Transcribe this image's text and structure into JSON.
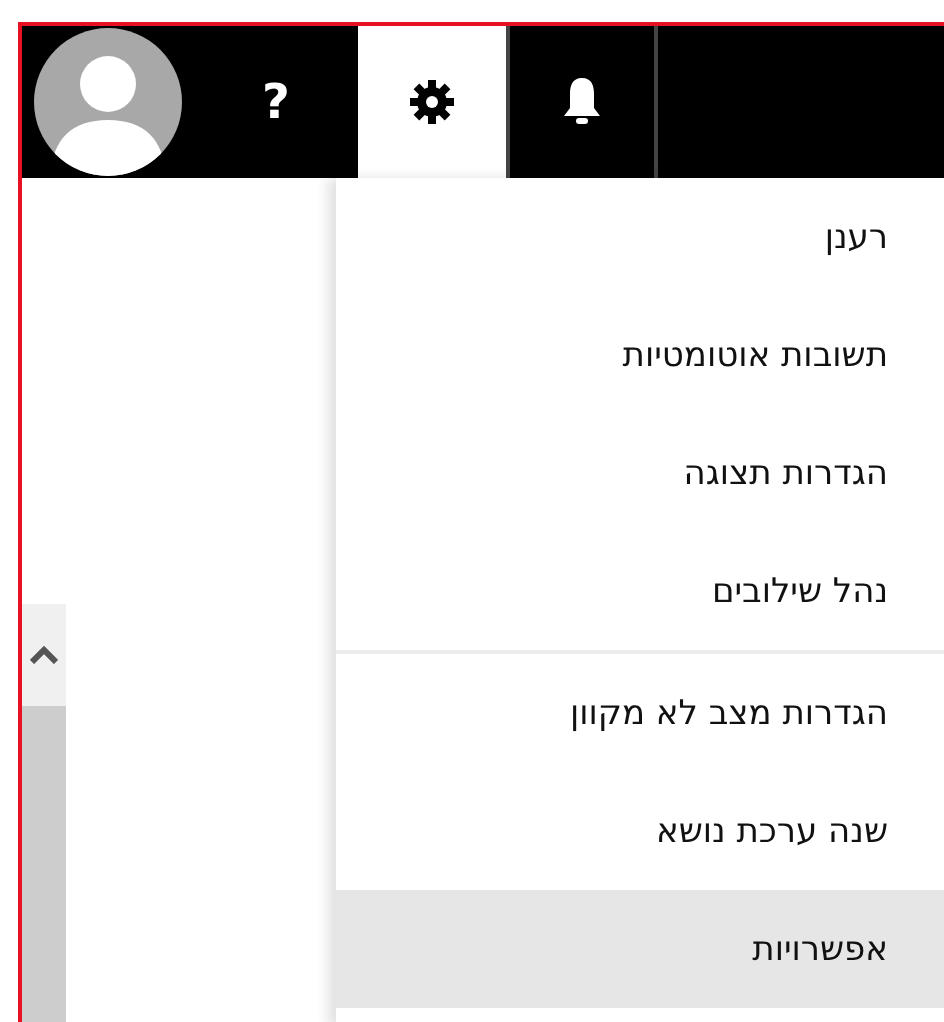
{
  "toolbar": [
    {
      "kind": "help",
      "text": "?",
      "selected": false
    },
    {
      "kind": "settings",
      "selected": true
    },
    {
      "kind": "notifications",
      "selected": false
    }
  ],
  "menu": {
    "groups": [
      {
        "items": [
          {
            "label": "רענן",
            "selected": false
          },
          {
            "label": "תשובות אוטומטיות",
            "selected": false
          },
          {
            "label": "הגדרות תצוגה",
            "selected": false
          },
          {
            "label": "נהל שילובים",
            "selected": false
          }
        ]
      },
      {
        "items": [
          {
            "label": "הגדרות מצב לא מקוון",
            "selected": false
          },
          {
            "label": "שנה ערכת נושא",
            "selected": false
          },
          {
            "label": "אפשרויות",
            "selected": true
          }
        ]
      }
    ]
  }
}
